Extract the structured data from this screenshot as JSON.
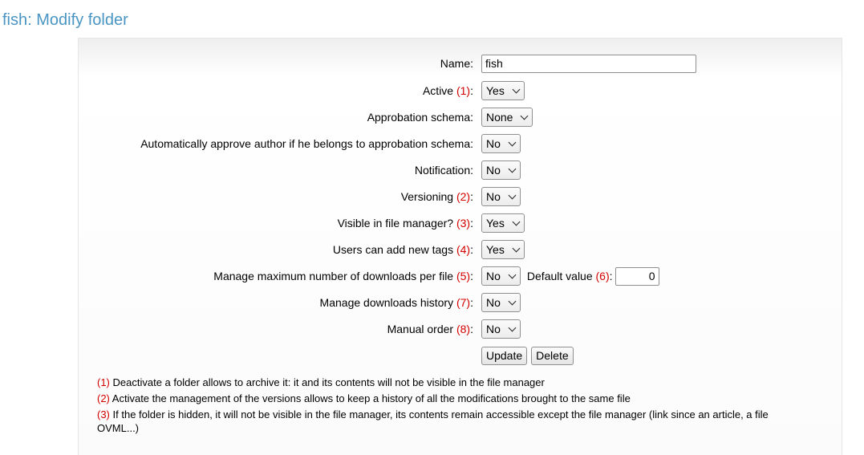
{
  "header": {
    "title": "fish: Modify folder"
  },
  "form": {
    "name": {
      "label": "Name:",
      "value": "fish"
    },
    "active": {
      "label": "Active",
      "num": "(1)",
      "colon": ":",
      "value": "Yes"
    },
    "approbation_schema": {
      "label": "Approbation schema:",
      "value": "None"
    },
    "auto_approve": {
      "label": "Automatically approve author if he belongs to approbation schema:",
      "value": "No"
    },
    "notification": {
      "label": "Notification:",
      "value": "No"
    },
    "versioning": {
      "label": "Versioning",
      "num": "(2)",
      "colon": ":",
      "value": "No"
    },
    "visible": {
      "label": "Visible in file manager?",
      "num": "(3)",
      "colon": ":",
      "value": "Yes"
    },
    "new_tags": {
      "label": "Users can add new tags",
      "num": "(4)",
      "colon": ":",
      "value": "Yes"
    },
    "max_downloads": {
      "label": "Manage maximum number of downloads per file",
      "num": "(5)",
      "colon": ":",
      "value": "No",
      "default_label": "Default value",
      "default_num": "(6)",
      "default_colon": ":",
      "default_value": "0"
    },
    "downloads_history": {
      "label": "Manage downloads history",
      "num": "(7)",
      "colon": ":",
      "value": "No"
    },
    "manual_order": {
      "label": "Manual order",
      "num": "(8)",
      "colon": ":",
      "value": "No"
    },
    "buttons": {
      "update": "Update",
      "delete": "Delete"
    }
  },
  "notes": [
    {
      "num": "(1)",
      "text": "Deactivate a folder allows to archive it: it and its contents will not be visible in the file manager"
    },
    {
      "num": "(2)",
      "text": "Activate the management of the versions allows to keep a history of all the modifications brought to the same file"
    },
    {
      "num": "(3)",
      "text": "If the folder is hidden, it will not be visible in the file manager, its contents remain accessible except the file manager (link since an article, a file OVML...)"
    }
  ]
}
